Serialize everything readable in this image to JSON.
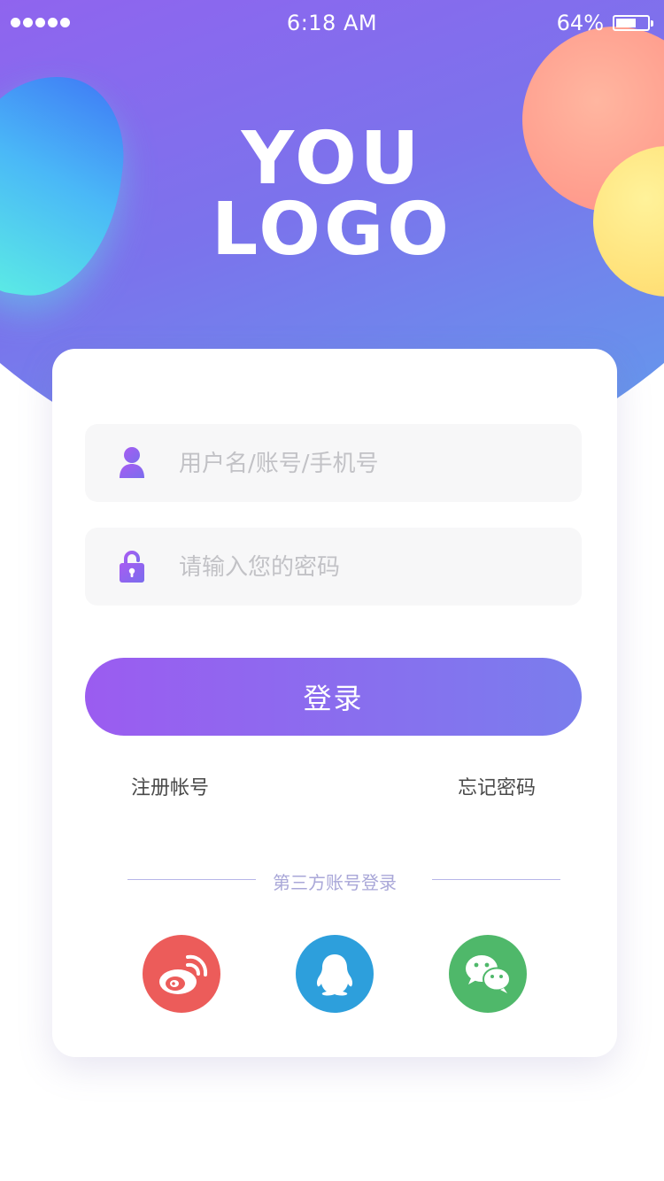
{
  "status_bar": {
    "signal_dots": 5,
    "time": "6:18 AM",
    "battery_percent": "64%",
    "battery_level": 0.64
  },
  "logo": {
    "line1": "YOU",
    "line2": "LOGO"
  },
  "form": {
    "username": {
      "icon": "user-icon",
      "placeholder": "用户名/账号/手机号",
      "value": ""
    },
    "password": {
      "icon": "unlock-icon",
      "placeholder": "请输入您的密码",
      "value": ""
    },
    "login_label": "登录",
    "register_label": "注册帐号",
    "forgot_label": "忘记密码"
  },
  "third_party": {
    "label": "第三方账号登录",
    "providers": [
      {
        "name": "weibo",
        "icon": "weibo-icon",
        "color": "#ec5c5a"
      },
      {
        "name": "qq",
        "icon": "qq-icon",
        "color": "#2d9fdc"
      },
      {
        "name": "wechat",
        "icon": "wechat-icon",
        "color": "#4fb86a"
      }
    ]
  },
  "colors": {
    "accent_start": "#9b5cf0",
    "accent_end": "#7a7ded",
    "header_top": "#c93cf6",
    "header_bottom": "#5ba8ec"
  }
}
